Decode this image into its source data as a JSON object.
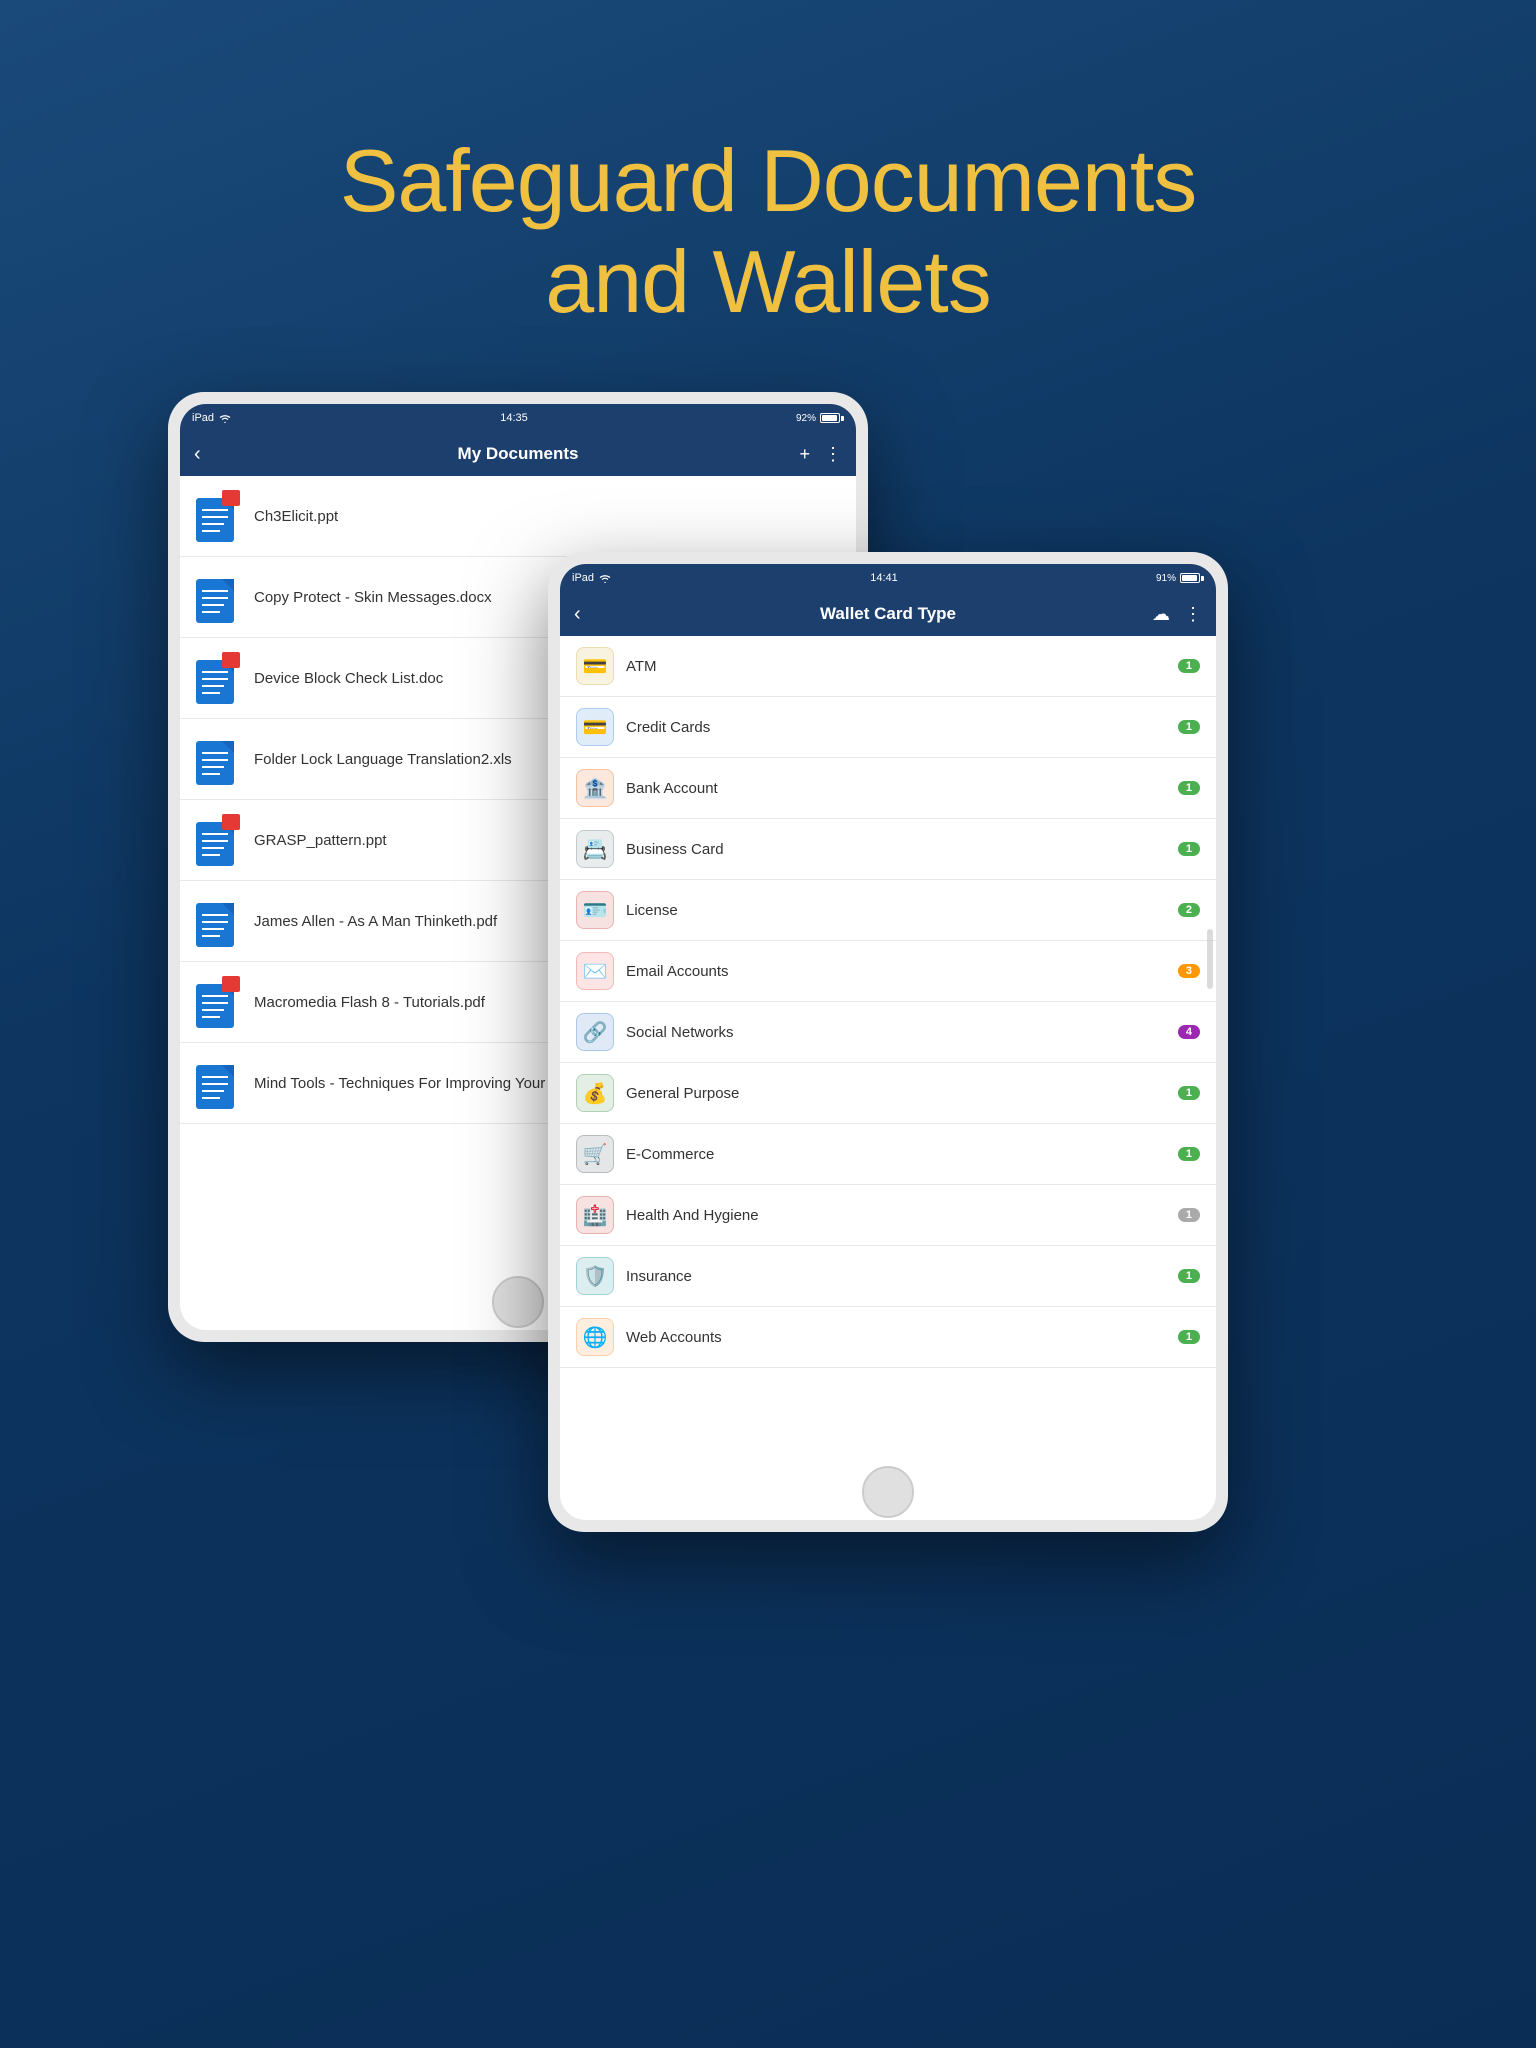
{
  "hero": {
    "line1": "Safeguard Documents",
    "line2": "and Wallets"
  },
  "ipad_left": {
    "status": {
      "device": "iPad",
      "time": "14:35",
      "battery": "92%"
    },
    "nav": {
      "back": "‹",
      "title": "My Documents",
      "add": "+",
      "more": "⋮"
    },
    "documents": [
      {
        "name": "Ch3Elicit.ppt"
      },
      {
        "name": "Copy Protect - Skin Messages.docx"
      },
      {
        "name": "Device Block Check List.doc"
      },
      {
        "name": "Folder Lock Language Translation2.xls"
      },
      {
        "name": "GRASP_pattern.ppt"
      },
      {
        "name": "James Allen - As A Man Thinketh.pdf"
      },
      {
        "name": "Macromedia Flash 8 - Tutorials.pdf"
      },
      {
        "name": "Mind Tools - Techniques For Improving Your Me..."
      }
    ]
  },
  "ipad_right": {
    "status": {
      "device": "iPad",
      "time": "14:41",
      "battery": "91%"
    },
    "nav": {
      "back": "‹",
      "title": "Wallet Card Type",
      "cloud": "☁",
      "more": "⋮"
    },
    "wallet_items": [
      {
        "name": "ATM",
        "badge": "1",
        "color": "#c8a020",
        "icon": "💳"
      },
      {
        "name": "Credit Cards",
        "badge": "1",
        "color": "#1976d2",
        "icon": "💳"
      },
      {
        "name": "Bank Account",
        "badge": "1",
        "color": "#e65100",
        "icon": "🏦"
      },
      {
        "name": "Business Card",
        "badge": "1",
        "color": "#546e7a",
        "icon": "📇"
      },
      {
        "name": "License",
        "badge": "2",
        "color": "#c62828",
        "icon": "🪪"
      },
      {
        "name": "Email Accounts",
        "badge": "3",
        "color": "#e53935",
        "icon": "✉️"
      },
      {
        "name": "Social Networks",
        "badge": "4",
        "color": "#1565c0",
        "icon": "🔗"
      },
      {
        "name": "General Purpose",
        "badge": "1",
        "color": "#2e7d32",
        "icon": "💰"
      },
      {
        "name": "E-Commerce",
        "badge": "1",
        "color": "#37474f",
        "icon": "🛒"
      },
      {
        "name": "Health And Hygiene",
        "badge": "1",
        "color": "#c62828",
        "icon": "🏥"
      },
      {
        "name": "Insurance",
        "badge": "1",
        "color": "#00838f",
        "icon": "🛡️"
      },
      {
        "name": "Web Accounts",
        "badge": "1",
        "color": "#f57f17",
        "icon": "🌐"
      }
    ]
  }
}
